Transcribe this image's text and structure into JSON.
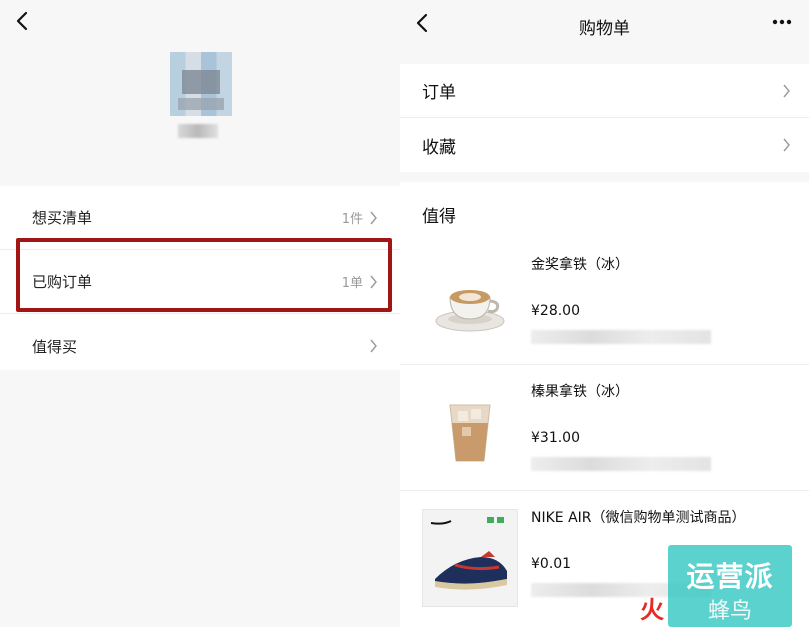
{
  "left": {
    "items": [
      {
        "label": "想买清单",
        "count": "1件"
      },
      {
        "label": "已购订单",
        "count": "1单"
      },
      {
        "label": "值得买",
        "count": ""
      }
    ]
  },
  "right": {
    "title": "购物单",
    "menu": [
      {
        "label": "订单"
      },
      {
        "label": "收藏"
      }
    ],
    "section_title": "值得",
    "products": [
      {
        "name": "金奖拿铁（冰）",
        "price": "¥28.00"
      },
      {
        "name": "榛果拿铁（冰）",
        "price": "¥31.00"
      },
      {
        "name": "NIKE AIR（微信购物单测试商品）",
        "price": "¥0.01"
      }
    ]
  },
  "watermark": {
    "top": "运营派",
    "bottom": "蜂鸟",
    "red": "火"
  },
  "colors": {
    "highlight": "#a31513",
    "watermark": "#38c9c4"
  }
}
